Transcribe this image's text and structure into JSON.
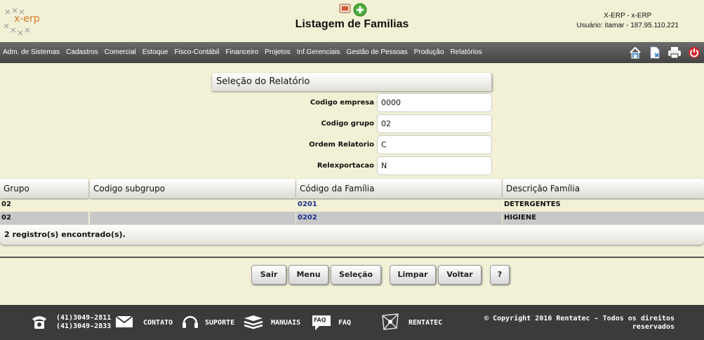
{
  "header": {
    "logo_text": "x-erp",
    "title": "Listagem de Familias",
    "system": "X-ERP - x-ERP",
    "user_line": "Usuário: itamar - 187.95.110.221"
  },
  "menu": {
    "items": [
      "Adm. de Sistemas",
      "Cadastros",
      "Comercial",
      "Estoque",
      "Fisco-Contábil",
      "Financeiro",
      "Projetos",
      "Inf.Gerenciais",
      "Gestão de Pessoas",
      "Produção",
      "Relatórios"
    ],
    "tools": [
      "home-icon",
      "document-icon",
      "print-icon",
      "power-icon"
    ]
  },
  "selection": {
    "title": "Seleção do Relatório",
    "fields": [
      {
        "label": "Codigo empresa",
        "value": "0000"
      },
      {
        "label": "Codigo grupo",
        "value": "02"
      },
      {
        "label": "Ordem Relatorio",
        "value": "C"
      },
      {
        "label": "Relexportacao",
        "value": "N"
      }
    ]
  },
  "table": {
    "columns": [
      "Grupo",
      "Codigo subgrupo",
      "Código da Família",
      "Descrição Família"
    ],
    "rows": [
      [
        "02",
        "",
        "0201",
        "DETERGENTES"
      ],
      [
        "02",
        "",
        "0202",
        "HIGIENE"
      ]
    ],
    "record_count": "2 registro(s) encontrado(s)."
  },
  "buttons": {
    "sair": "Sair",
    "menu": "Menu",
    "selecao": "Seleção",
    "limpar": "Limpar",
    "voltar": "Voltar",
    "help": "?"
  },
  "footer": {
    "phone1": "(41)3049-2811",
    "phone2": "(41)3049-2833",
    "contato": "CONTATO",
    "suporte": "SUPORTE",
    "manuais": "MANUAIS",
    "faq_badge": "FAQ",
    "faq": "FAQ",
    "rentatec": "RENTATEC",
    "copyright_1": "© Copyright 2016 Rentatec - Todos os direitos",
    "copyright_2": "reservados"
  },
  "colors": {
    "background": "#f2f1d6",
    "menubar": "#4f4f4f",
    "footer": "#3b3b3b",
    "link": "#1c2f8e",
    "logo": "#d6792b"
  }
}
